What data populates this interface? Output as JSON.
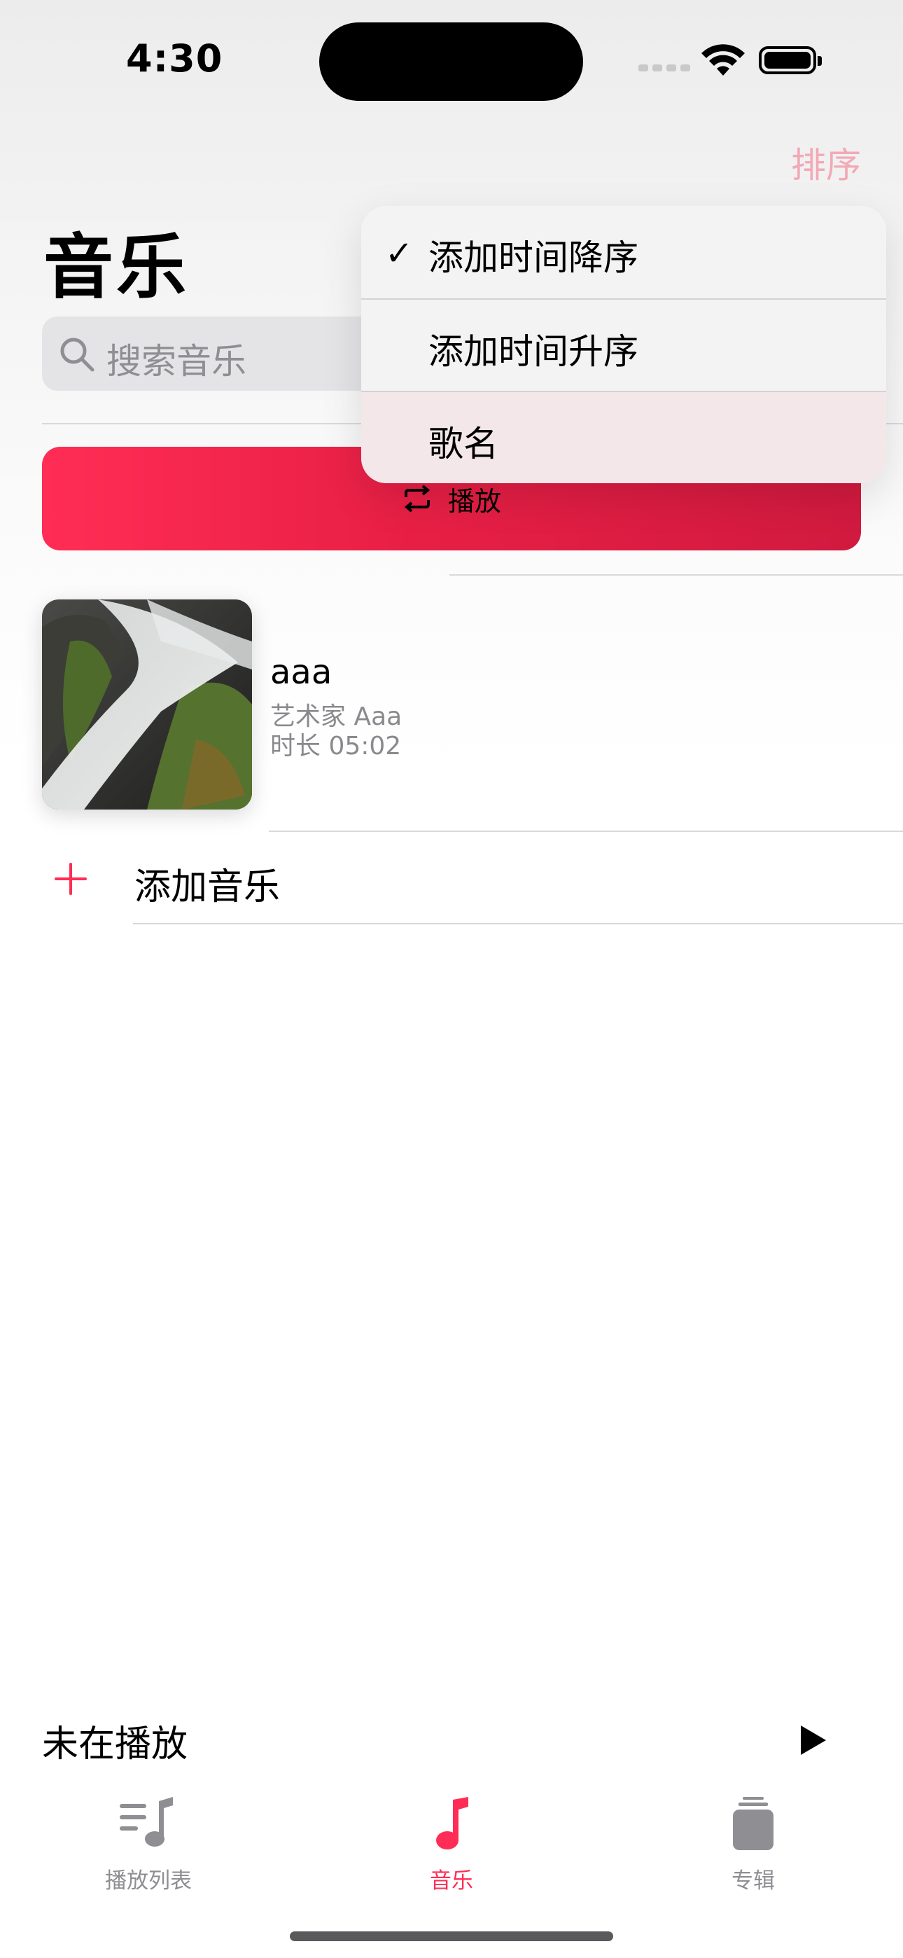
{
  "status_bar": {
    "time": "4:30"
  },
  "header": {
    "sort_label": "排序",
    "title": "音乐"
  },
  "search": {
    "placeholder": "搜索音乐"
  },
  "play_button": {
    "label": "播放"
  },
  "songs": [
    {
      "title": "aaa",
      "artist": "艺术家 Aaa",
      "duration": "时长 05:02"
    }
  ],
  "add_music": {
    "label": "添加音乐"
  },
  "sort_menu": {
    "items": [
      {
        "label": "添加时间降序",
        "checked": true
      },
      {
        "label": "添加时间升序",
        "checked": false
      },
      {
        "label": "歌名",
        "checked": false
      }
    ]
  },
  "now_playing": {
    "label": "未在播放"
  },
  "tab_bar": {
    "tabs": [
      {
        "label": "播放列表",
        "icon": "playlist-icon",
        "active": false
      },
      {
        "label": "音乐",
        "icon": "music-note-icon",
        "active": true
      },
      {
        "label": "专辑",
        "icon": "album-stack-icon",
        "active": false
      }
    ]
  },
  "colors": {
    "accent": "#ff2d55",
    "secondary_text": "#8a8a8e"
  }
}
